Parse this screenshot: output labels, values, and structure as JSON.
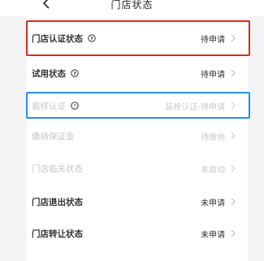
{
  "nav": {
    "title": "门店状态",
    "back_icon": "chevron-left-icon"
  },
  "rows": [
    {
      "label": "门店认证状态",
      "has_help": true,
      "status": "待申请",
      "disabled": false,
      "highlight": "red"
    },
    {
      "label": "试用状态",
      "has_help": true,
      "status": "待申请",
      "disabled": false
    },
    {
      "label": "装修认证",
      "has_help": true,
      "status": "装修认证-待申请",
      "disabled": true,
      "highlight": "blue"
    },
    {
      "label": "缴纳保证金",
      "has_help": false,
      "status": "待缴纳",
      "disabled": true
    },
    {
      "label": "门店临关状态",
      "has_help": false,
      "status": "未启动",
      "disabled": true
    },
    {
      "label": "门店退出状态",
      "has_help": false,
      "status": "未申请",
      "disabled": false
    },
    {
      "label": "门店转让状态",
      "has_help": false,
      "status": "未申请",
      "disabled": false
    }
  ],
  "colors": {
    "highlight_red": "#e0291f",
    "highlight_blue": "#2b8de8"
  }
}
